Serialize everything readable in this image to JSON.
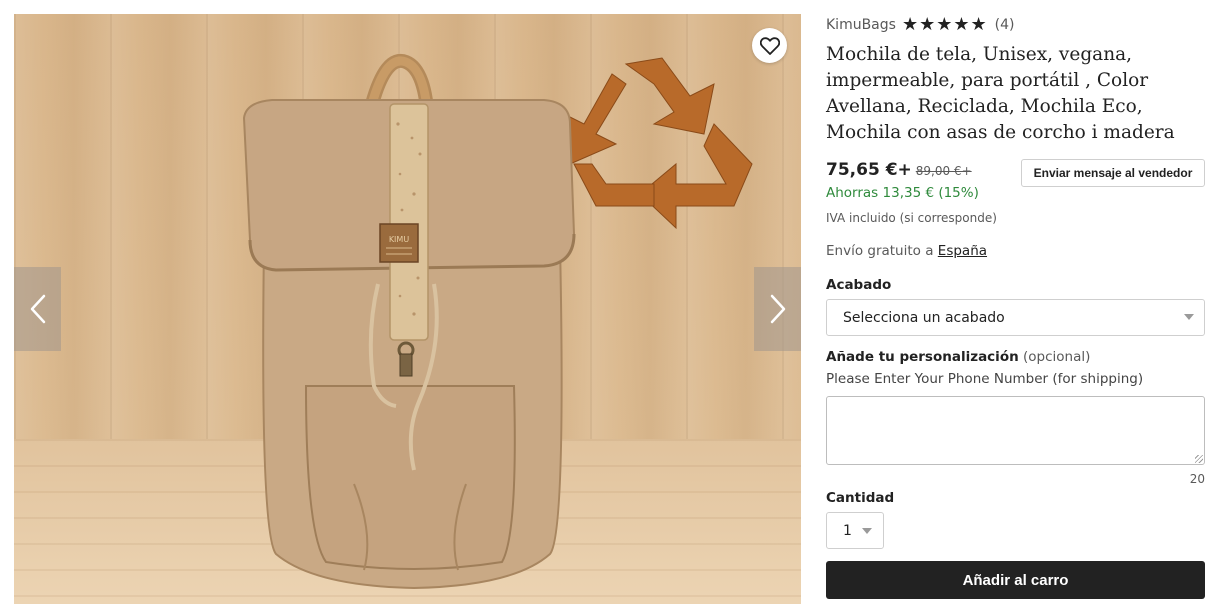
{
  "product": {
    "shop_name": "KimuBags",
    "rating_stars": 5,
    "review_count": "(4)",
    "title": "Mochila de tela, Unisex, vegana, impermeable, para portátil , Color Avellana, Reciclada, Mochila Eco, Mochila con asas de corcho i madera",
    "price": "75,65 €+",
    "original_price": "89,00 €+",
    "savings": "Ahorras 13,35 € (15%)",
    "tax_note": "IVA incluido (si corresponde)",
    "message_button": "Enviar mensaje al vendedor",
    "shipping_prefix": "Envío gratuito a",
    "shipping_country": "España"
  },
  "options": {
    "finish_label": "Acabado",
    "finish_selected": "Selecciona un acabado",
    "personalization_label": "Añade tu personalización",
    "personalization_optional": "(opcional)",
    "personalization_hint": "Please Enter Your Phone Number (for shipping)",
    "personalization_value": "",
    "char_counter": "20",
    "quantity_label": "Cantidad",
    "quantity_selected": "1"
  },
  "actions": {
    "add_to_cart": "Añadir al carro"
  },
  "gallery": {
    "tag_text": "KIMU"
  },
  "icons": {
    "favorite": "heart-icon",
    "prev": "chevron-left-icon",
    "next": "chevron-right-icon",
    "rating": "star-icon",
    "dropdown": "caret-down-icon"
  },
  "colors": {
    "primary_button": "#222222",
    "savings_green": "#2f8a3c",
    "recycle_symbol": "#b86a2a"
  }
}
